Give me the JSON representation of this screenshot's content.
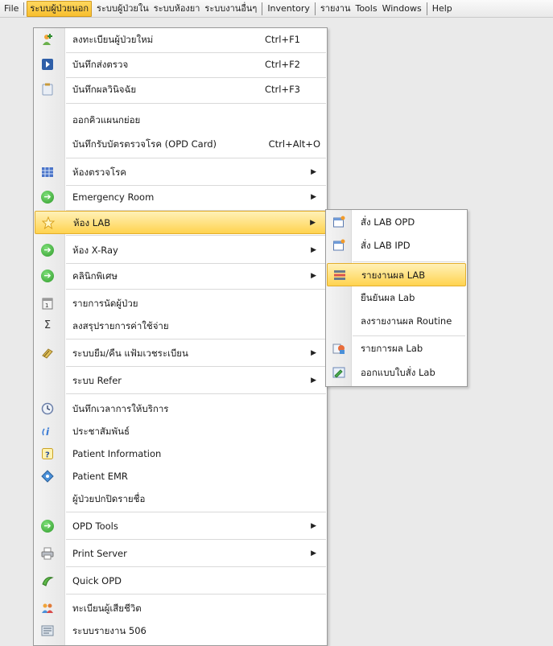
{
  "menubar": {
    "items": [
      "File",
      "ระบบผู้ป่วยนอก",
      "ระบบผู้ป่วยใน",
      "ระบบห้องยา",
      "ระบบงานอื่นๆ",
      "Inventory",
      "รายงาน",
      "Tools",
      "Windows",
      "Help"
    ]
  },
  "menu": {
    "items": [
      {
        "label": "ลงทะเบียนผู้ป่วยใหม่",
        "shortcut": "Ctrl+F1",
        "icon": "add-patient-icon"
      },
      {
        "label": "บันทึกส่งตรวจ",
        "shortcut": "Ctrl+F2",
        "icon": "send-icon"
      },
      {
        "label": "บันทึกผลวินิจฉัย",
        "shortcut": "Ctrl+F3",
        "icon": "clipboard-icon"
      },
      {
        "label": "ออกคิวแผนกย่อย",
        "shortcut": ""
      },
      {
        "label": "บันทึกรับบัตรตรวจโรค (OPD Card)",
        "shortcut": "Ctrl+Alt+O"
      },
      {
        "label": "ห้องตรวจโรค",
        "submenu": true,
        "icon": "grid-icon"
      },
      {
        "label": "Emergency Room",
        "submenu": true,
        "icon": "green-arrow-icon"
      },
      {
        "label": "ห้อง LAB",
        "submenu": true,
        "icon": "star-icon"
      },
      {
        "label": "ห้อง X-Ray",
        "submenu": true,
        "icon": "green-arrow-icon"
      },
      {
        "label": "คลินิกพิเศษ",
        "submenu": true,
        "icon": "green-arrow-icon"
      },
      {
        "label": "รายการนัดผู้ป่วย",
        "icon": "calendar-icon"
      },
      {
        "label": "ลงสรุปรายการค่าใช้จ่าย",
        "icon": "sigma-icon"
      },
      {
        "label": "ระบบยืม/คืน แฟ้มเวชระเบียน",
        "submenu": true,
        "icon": "folder-icon"
      },
      {
        "label": "ระบบ Refer",
        "submenu": true
      },
      {
        "label": "บันทึกเวลาการให้บริการ",
        "icon": "clock-icon"
      },
      {
        "label": "ประชาสัมพันธ์",
        "icon": "info-icon"
      },
      {
        "label": "Patient Information",
        "icon": "help-icon"
      },
      {
        "label": "Patient EMR",
        "icon": "diamond-icon"
      },
      {
        "label": "ผู้ป่วยปกปิดรายชื่อ"
      },
      {
        "label": "OPD Tools",
        "submenu": true,
        "icon": "green-arrow-icon"
      },
      {
        "label": "Print Server",
        "submenu": true,
        "icon": "printer-icon"
      },
      {
        "label": "Quick OPD",
        "icon": "quick-icon"
      },
      {
        "label": "ทะเบียนผู้เสียชีวิต",
        "icon": "people-icon"
      },
      {
        "label": "ระบบรายงาน 506",
        "icon": "report-icon"
      }
    ]
  },
  "submenu": {
    "items": [
      {
        "label": "สั่ง LAB OPD",
        "icon": "new-window-icon"
      },
      {
        "label": "สั่ง LAB IPD",
        "icon": "new-window-icon"
      },
      {
        "label": "รายงานผล LAB",
        "icon": "list-icon"
      },
      {
        "label": "ยืนยันผล Lab"
      },
      {
        "label": "ลงรายงานผล Routine"
      },
      {
        "label": "รายการผล Lab",
        "icon": "lab-list-icon"
      },
      {
        "label": "ออกแบบใบสั่ง Lab",
        "icon": "design-icon"
      }
    ]
  }
}
